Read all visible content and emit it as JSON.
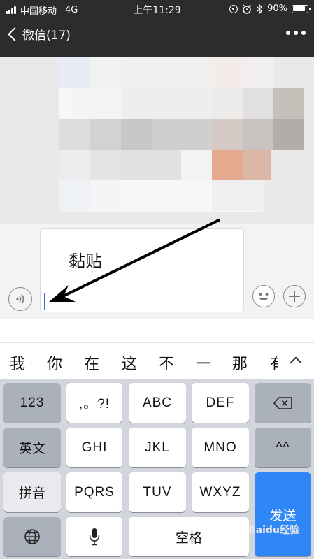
{
  "status_bar": {
    "carrier": "中国移动",
    "network": "4G",
    "time": "上午11:29",
    "battery": "90%"
  },
  "nav": {
    "back_label": "微信(17)"
  },
  "input": {
    "text": "黏贴"
  },
  "candidates": [
    "我",
    "你",
    "在",
    "这",
    "不",
    "一",
    "那",
    "有"
  ],
  "keyboard": {
    "row1": [
      "123",
      ",。?!",
      "ABC",
      "DEF"
    ],
    "row2": [
      "英文",
      "GHI",
      "JKL",
      "MNO",
      "^^"
    ],
    "row3": [
      "拼音",
      "PQRS",
      "TUV",
      "WXYZ"
    ],
    "space": "空格",
    "send": "发送"
  },
  "watermark": "Baidu经验",
  "colors": {
    "header_bg": "#2c2c2c",
    "send_key": "#2f86f6",
    "caret": "#2e6bd7"
  }
}
